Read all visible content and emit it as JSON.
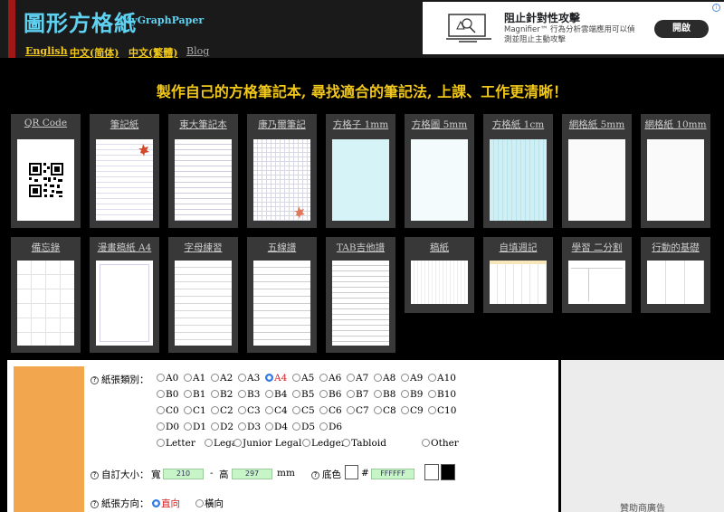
{
  "header": {
    "title": "圖形方格紙",
    "subtitle": "MyGraphPaper",
    "languages": [
      "English",
      "中文(简体)",
      "中文(繁體)"
    ],
    "blog": "Blog"
  },
  "ad": {
    "title": "阻止針對性攻擊",
    "description": "Magnifier™ 行為分析雲端應用可以偵測並阻止主動攻擊",
    "button": "開啟",
    "info": "i"
  },
  "headline": "製作自己的方格筆記本, 尋找適合的筆記法, 上課、工作更清晰！",
  "papers_row1": [
    "QR Code",
    "筆記紙",
    "東大筆記本",
    "康乃爾筆記",
    "方格子 1mm",
    "方格圖 5mm",
    "方格紙 1cm",
    "網格紙 5mm",
    "網格紙 10mm"
  ],
  "papers_row2": [
    "備忘錄",
    "漫畫稿紙 A4",
    "字母練習",
    "五線譜",
    "TAB吉他譜",
    "稿紙",
    "自填週記",
    "學習 二分割",
    "行動的基礎"
  ],
  "settings": {
    "paper_type_label": "紙張類別：",
    "a_sizes": [
      "A0",
      "A1",
      "A2",
      "A3",
      "A4",
      "A5",
      "A6",
      "A7",
      "A8",
      "A9",
      "A10"
    ],
    "b_sizes": [
      "B0",
      "B1",
      "B2",
      "B3",
      "B4",
      "B5",
      "B6",
      "B7",
      "B8",
      "B9",
      "B10"
    ],
    "c_sizes": [
      "C0",
      "C1",
      "C2",
      "C3",
      "C4",
      "C5",
      "C6",
      "C7",
      "C8",
      "C9",
      "C10"
    ],
    "d_sizes": [
      "D0",
      "D1",
      "D2",
      "D3",
      "D4",
      "D5",
      "D6"
    ],
    "other_sizes": [
      "Letter",
      "Legal",
      "Junior Legal",
      "Ledger",
      "Tabloid",
      "Other"
    ],
    "selected_size": "A4",
    "custom_size_label": "自訂大小：",
    "width_label": "寬",
    "width_value": "210",
    "dash": "-",
    "height_label": "高",
    "height_value": "297",
    "unit": "mm",
    "bg_color_label": "底色",
    "hash": "#",
    "bg_color_value": "FFFFFF",
    "orientation_label": "紙張方向：",
    "orientation_options": [
      "直向",
      "橫向"
    ],
    "selected_orientation": "直向",
    "help_glyph": "?"
  },
  "sponsor_label": "贊助商廣告",
  "colors": {
    "accent_blue": "#5fd2f2",
    "accent_yellow": "#f2c81a",
    "header_red": "#a01818",
    "orange_panel": "#f2a64e",
    "input_green": "#c8f5c8"
  }
}
